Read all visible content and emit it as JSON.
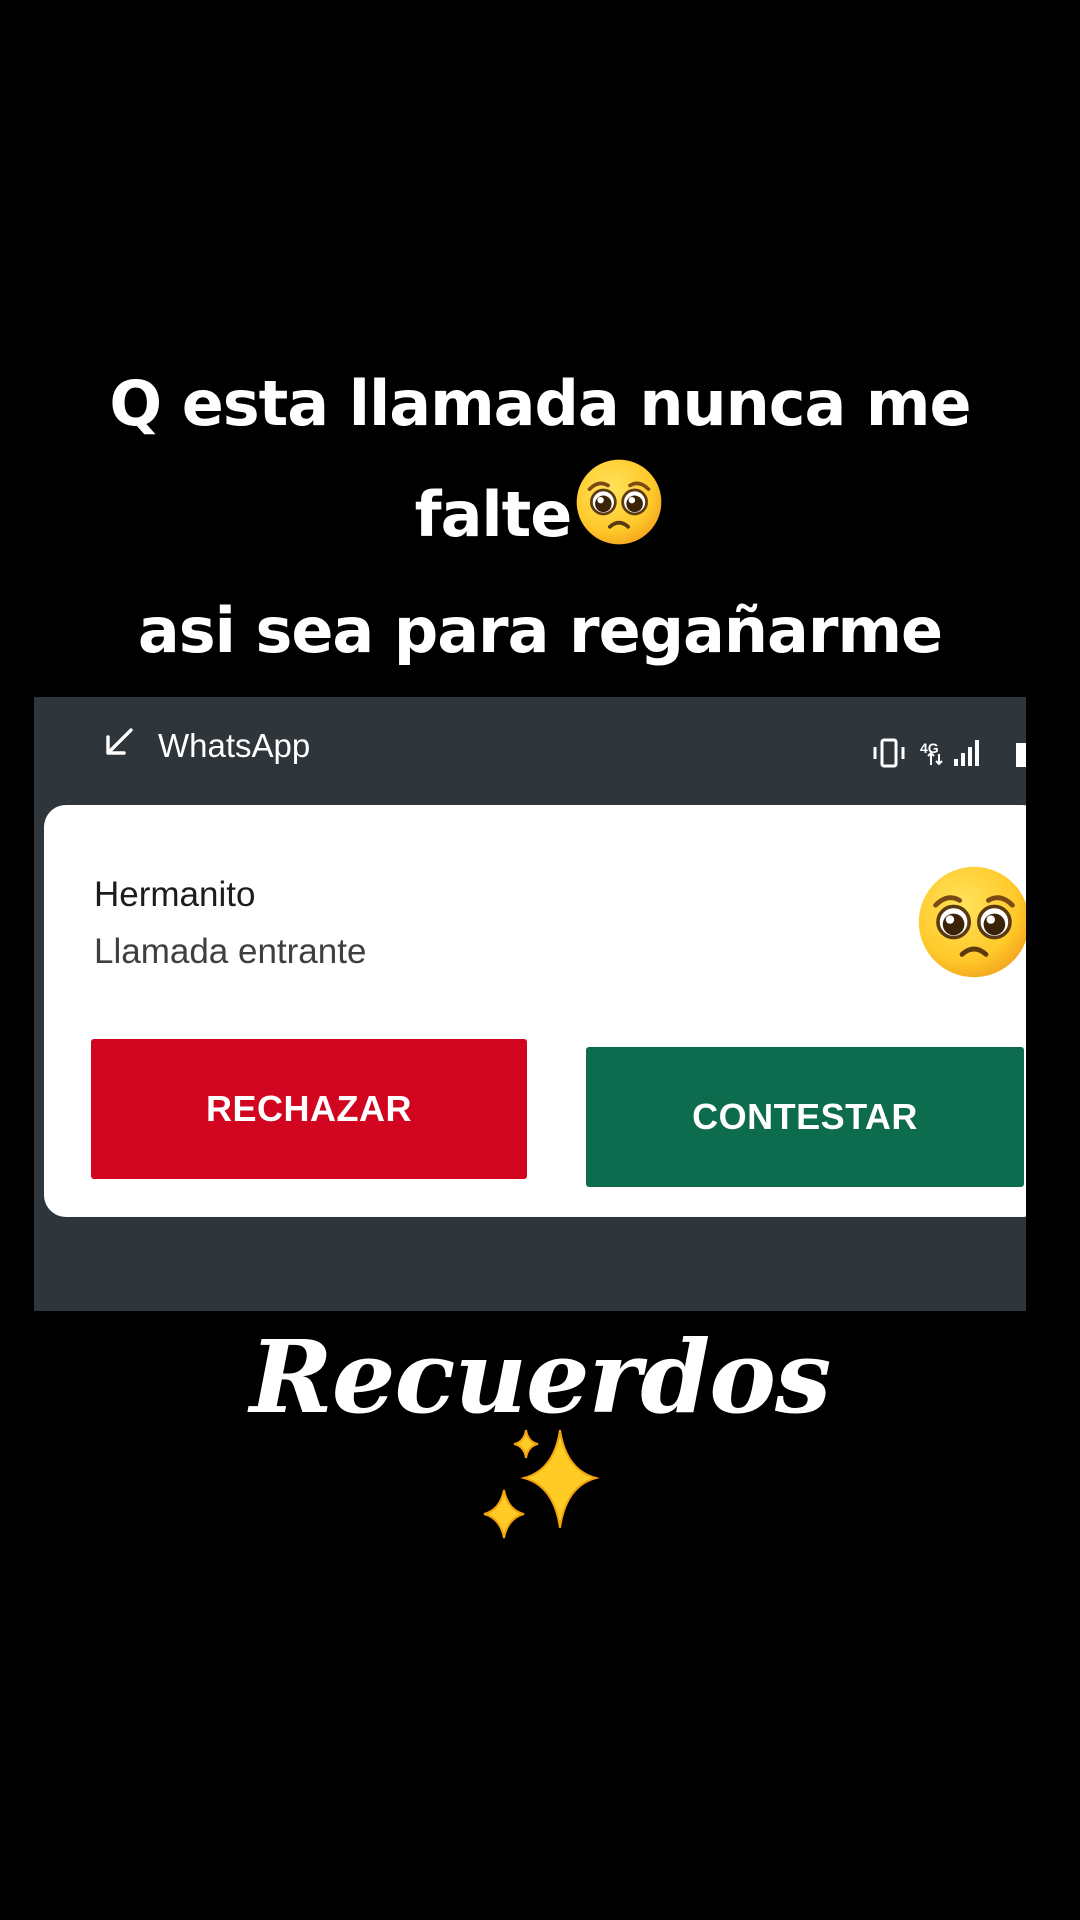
{
  "caption": {
    "line1": "Q esta llamada nunca me",
    "line2": "falte",
    "line3": "asi sea para regañarme",
    "emoji": "pleading-face-emoji"
  },
  "notification": {
    "app_name": "WhatsApp",
    "direction_icon": "incoming-call-arrow-icon",
    "status_icons": [
      "vibrate-icon",
      "4g-icon",
      "signal-bars-icon",
      "battery-icon"
    ],
    "caller": "Hermanito",
    "status": "Llamada entrante",
    "avatar": "pleading-face-emoji",
    "decline_label": "RECHAZAR",
    "accept_label": "CONTESTAR",
    "network_label": "4G"
  },
  "footer": {
    "title": "Recuerdos",
    "emoji": "sparkles-emoji"
  },
  "colors": {
    "background": "#000000",
    "decline": "#d1051f",
    "accept": "#0d6b4e",
    "panel": "#2e353b",
    "card": "#ffffff",
    "emoji_face": "#ffcc2e"
  }
}
